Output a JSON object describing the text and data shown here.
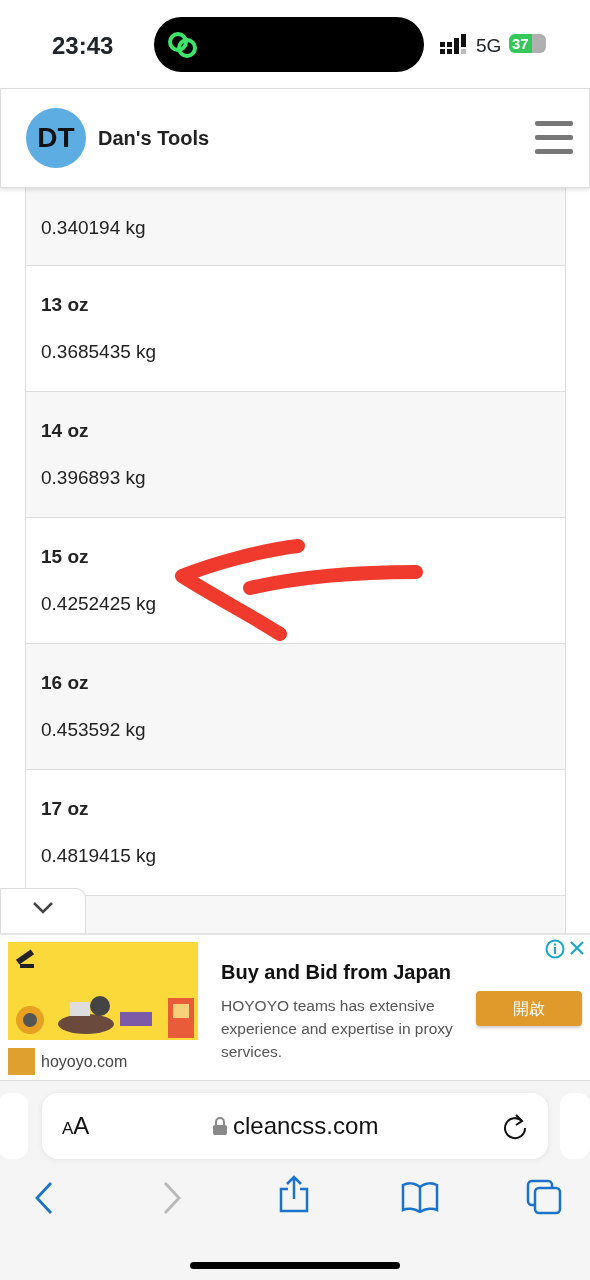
{
  "status_bar": {
    "time": "23:43",
    "network": "5G",
    "battery": "37"
  },
  "header": {
    "logo": "DT",
    "title": "Dan's Tools"
  },
  "conversions": [
    {
      "value": "0.340194 kg"
    },
    {
      "label": "13 oz",
      "value": "0.3685435 kg"
    },
    {
      "label": "14 oz",
      "value": "0.396893 kg"
    },
    {
      "label": "15 oz",
      "value": "0.4252425 kg"
    },
    {
      "label": "16 oz",
      "value": "0.453592 kg"
    },
    {
      "label": "17 oz",
      "value": "0.4819415 kg"
    }
  ],
  "ad": {
    "title": "Buy and Bid from Japan",
    "description": "HOYOYO teams has extensive experience and expertise in proxy services.",
    "button": "開啟",
    "domain": "hoyoyo.com"
  },
  "browser": {
    "text_size": "AA",
    "url": "cleancss.com",
    "back_enabled": true,
    "forward_enabled": false
  }
}
